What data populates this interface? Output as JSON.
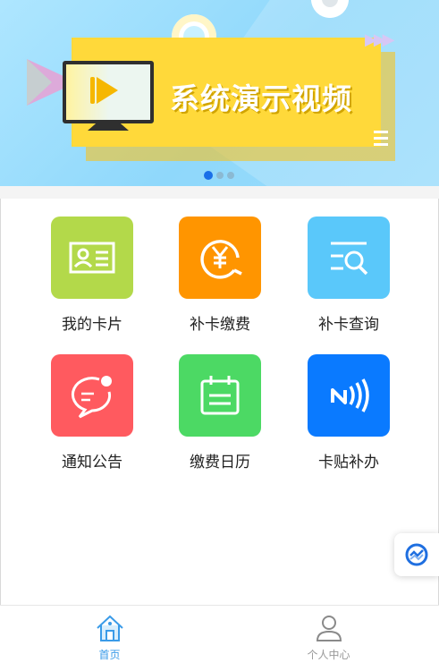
{
  "banner": {
    "title": "系统演示视频",
    "slides": 3,
    "active_slide": 1
  },
  "menu": [
    {
      "label": "我的卡片",
      "color": "#b3d94a",
      "icon": "id-card-icon"
    },
    {
      "label": "补卡缴费",
      "color": "#ff9500",
      "icon": "yuan-payment-icon"
    },
    {
      "label": "补卡查询",
      "color": "#5ac8fa",
      "icon": "list-search-icon"
    },
    {
      "label": "通知公告",
      "color": "#ff5a5f",
      "icon": "chat-notification-icon"
    },
    {
      "label": "缴费日历",
      "color": "#4cd964",
      "icon": "calendar-icon"
    },
    {
      "label": "卡贴补办",
      "color": "#0a7aff",
      "icon": "nfc-icon"
    }
  ],
  "tabbar": {
    "tabs": [
      {
        "label": "首页",
        "icon": "home-icon",
        "active": true,
        "color": "#3a9be8"
      },
      {
        "label": "个人中心",
        "icon": "user-icon",
        "active": false,
        "color": "#999999"
      }
    ]
  }
}
